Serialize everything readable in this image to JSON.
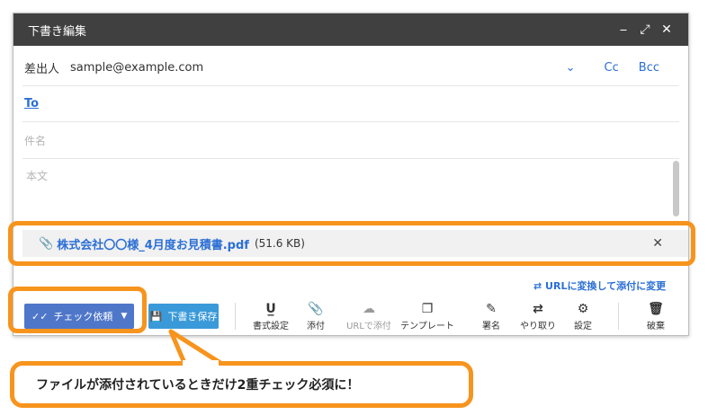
{
  "window": {
    "title": "下書き編集",
    "controls": {
      "minimize": "⎯",
      "expand": "⤢",
      "close": "✕"
    }
  },
  "from": {
    "label": "差出人",
    "value": "sample@example.com"
  },
  "recipients": {
    "chevron": "⌄",
    "cc": "Cc",
    "bcc": "Bcc",
    "to": "To"
  },
  "subject": {
    "placeholder": "件名"
  },
  "body": {
    "placeholder": "本文"
  },
  "attachment": {
    "icon": "paperclip-icon",
    "filename": "株式会社〇〇様_4月度お見積書.pdf",
    "size": "(51.6 KB)",
    "close": "✕"
  },
  "url_replace_link": "⇄ URLに変換して添付に変更",
  "toolbar": {
    "check_request": {
      "label": "チェック依頼",
      "icon": "✓✓",
      "dropdown": "▼"
    },
    "save_draft": {
      "label": "下書き保存",
      "icon": "💾"
    },
    "tools": [
      {
        "name": "format",
        "icon": "U̲",
        "label": "書式設定",
        "enabled": true
      },
      {
        "name": "attach",
        "icon": "📎",
        "label": "添付",
        "enabled": true
      },
      {
        "name": "url-attach",
        "icon": "☁",
        "label": "URLで添付",
        "enabled": false
      },
      {
        "name": "template",
        "icon": "❐",
        "label": "テンプレート",
        "enabled": true
      },
      {
        "name": "signature",
        "icon": "✎",
        "label": "署名",
        "enabled": true
      },
      {
        "name": "thread",
        "icon": "⇄",
        "label": "やり取り",
        "enabled": true
      },
      {
        "name": "settings",
        "icon": "⚙",
        "label": "設定",
        "enabled": true
      },
      {
        "name": "discard",
        "icon": "🗑",
        "label": "破棄",
        "enabled": true
      }
    ]
  },
  "annotation": {
    "callout_text": "ファイルが添付されているときだけ2重チェック必須に！",
    "color": "#f7941d"
  }
}
